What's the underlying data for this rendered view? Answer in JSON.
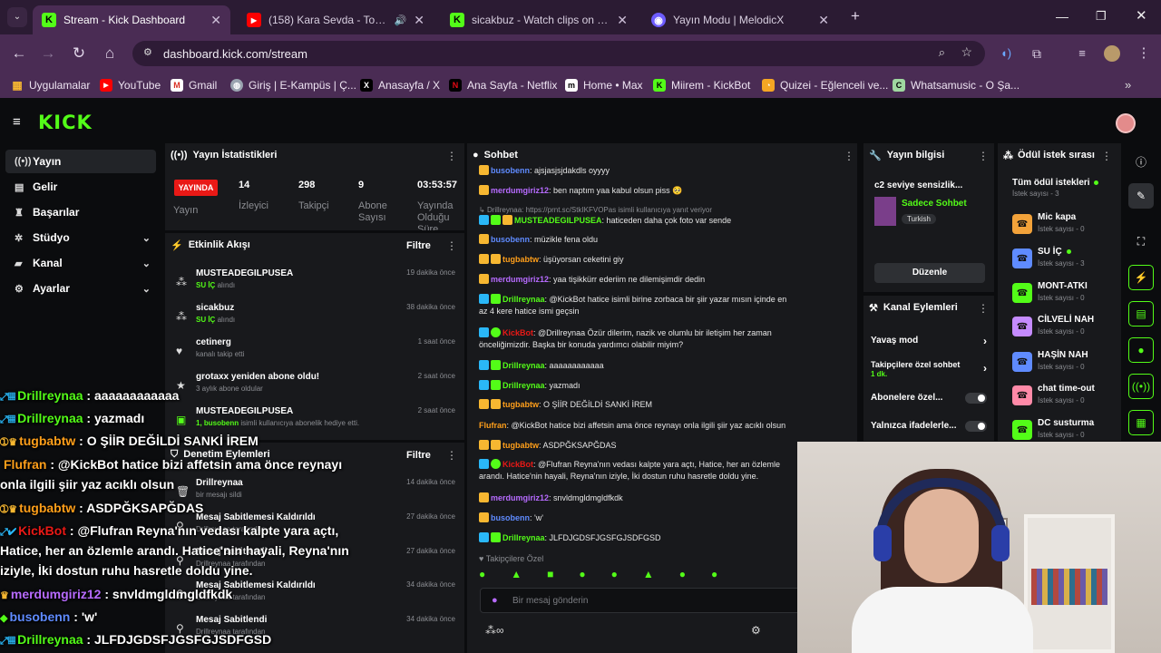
{
  "browser": {
    "tabs": [
      {
        "title": "Stream - Kick Dashboard",
        "icon": "kick-icon",
        "active": true
      },
      {
        "title": "(158) Kara Sevda - Toygar I",
        "icon": "youtube-icon",
        "active": false
      },
      {
        "title": "sicakbuz - Watch clips on Kick",
        "icon": "kick-icon",
        "active": false
      },
      {
        "title": "Yayın Modu | MelodicX",
        "icon": "melodicx-icon",
        "active": false
      }
    ],
    "url": "dashboard.kick.com/stream",
    "bookmarks": [
      {
        "label": "Uygulamalar",
        "icon": "apps-icon"
      },
      {
        "label": "YouTube",
        "icon": "youtube-icon"
      },
      {
        "label": "Gmail",
        "icon": "gmail-icon"
      },
      {
        "label": "Giriş | E-Kampüs | Ç...",
        "icon": "campus-icon"
      },
      {
        "label": "Anasayfa / X",
        "icon": "x-icon"
      },
      {
        "label": "Ana Sayfa - Netflix",
        "icon": "netflix-icon"
      },
      {
        "label": "Home • Max",
        "icon": "max-icon"
      },
      {
        "label": "Miirem - KickBot",
        "icon": "kickbot-icon"
      },
      {
        "label": "Quizei - Eğlenceli ve...",
        "icon": "quizei-icon"
      },
      {
        "label": "Whatsamusic - O Şa...",
        "icon": "whatsamusic-icon"
      }
    ]
  },
  "kick": {
    "logo": "KICK",
    "sidebar": [
      {
        "label": "Yayın",
        "icon": "stream-icon",
        "active": true
      },
      {
        "label": "Gelir",
        "icon": "revenue-icon"
      },
      {
        "label": "Başarılar",
        "icon": "trophy-icon"
      },
      {
        "label": "Stüdyo",
        "icon": "studio-icon",
        "expandable": true
      },
      {
        "label": "Kanal",
        "icon": "channel-icon",
        "expandable": true
      },
      {
        "label": "Ayarlar",
        "icon": "settings-icon",
        "expandable": true
      }
    ],
    "stats": {
      "title": "Yayın İstatistikleri",
      "live_badge": "YAYINDA",
      "items": [
        {
          "value": "",
          "label": "Yayın"
        },
        {
          "value": "14",
          "label": "İzleyici"
        },
        {
          "value": "298",
          "label": "Takipçi"
        },
        {
          "value": "9",
          "label": "Abone Sayısı"
        },
        {
          "value": "03:53:57",
          "label": "Yayında Olduğu Süre"
        }
      ]
    },
    "activity": {
      "title": "Etkinlik Akışı",
      "filter": "Filtre",
      "events": [
        {
          "name": "MUSTEADEGILPUSEA",
          "highlight": "SU İÇ",
          "sub": "alındı",
          "time": "19 dakika önce"
        },
        {
          "name": "sicakbuz",
          "highlight": "SU İÇ",
          "sub": "alındı",
          "time": "38 dakika önce"
        },
        {
          "name": "cetinerg",
          "highlight": "",
          "sub": "kanalı takip etti",
          "time": "1 saat önce"
        },
        {
          "name": "grotaxx yeniden abone oldu!",
          "highlight": "",
          "sub": "3 aylık abone oldular",
          "time": "2 saat önce"
        },
        {
          "name": "MUSTEADEGILPUSEA",
          "highlight": "1, busobenn",
          "sub": "isimli kullanıcıya abonelik hediye etti.",
          "time": "2 saat önce"
        }
      ]
    },
    "moderation": {
      "title": "Denetim Eylemleri",
      "filter": "Filtre",
      "events": [
        {
          "name": "Drillreynaa",
          "sub": "bir mesajı sildi",
          "time": "14 dakika önce"
        },
        {
          "name": "Mesaj Sabitlemesi Kaldırıldı",
          "sub": "Drillreynaa tarafından",
          "time": "27 dakika önce"
        },
        {
          "name": "Mesaj Sabitlendi",
          "sub": "Drillreynaa tarafından",
          "time": "27 dakika önce"
        },
        {
          "name": "Mesaj Sabitlemesi Kaldırıldı",
          "sub": "Drillreynaa tarafından",
          "time": "34 dakika önce"
        },
        {
          "name": "Mesaj Sabitlendi",
          "sub": "Drillreynaa tarafından",
          "time": "34 dakika önce"
        }
      ]
    },
    "chat": {
      "title": "Sohbet",
      "messages": [
        {
          "user": "busobenn",
          "color": "#5f8bff",
          "text": "ajsjasjsjdakdls oyyyy"
        },
        {
          "user": "merdumgiriz12",
          "color": "#b76bff",
          "text": "ben naptım yaa kabul olsun piss"
        },
        {
          "user": "MUSTEADEGILPUSEA",
          "color": "#53fc18",
          "text": "haticeden daha çok foto var sende",
          "reply": "Drillreynaa: https://prnt.sc/StkIKFVOPas isimli kullanıcıya yanıt veriyor"
        },
        {
          "user": "busobenn",
          "color": "#5f8bff",
          "text": "müzikle fena oldu"
        },
        {
          "user": "tugbabtw",
          "color": "#ff9f1a",
          "text": "üşüyorsan ceketini giy"
        },
        {
          "user": "merdumgiriz12",
          "color": "#b76bff",
          "text": "yaa tişikkürr ederiim  ne dilemişimdir dedin"
        },
        {
          "user": "Drillreynaa",
          "color": "#53fc18",
          "text": "@KickBot hatice isimli birine zorbaca bir şiir yazar mısın içinde en az 4 kere hatice ismi geçsin"
        },
        {
          "user": "KickBot",
          "color": "#e91916",
          "text": "@Drillreynaa Özür dilerim, nazik ve olumlu bir iletişim her zaman önceliğimizdir. Başka bir konuda yardımcı olabilir miyim?"
        },
        {
          "user": "Drillreynaa",
          "color": "#53fc18",
          "text": "aaaaaaaaaaaa"
        },
        {
          "user": "Drillreynaa",
          "color": "#53fc18",
          "text": "yazmadı"
        },
        {
          "user": "tugbabtw",
          "color": "#ff9f1a",
          "text": "O ŞİİR DEĞİLDİ SANKİ İREM"
        },
        {
          "user": "Flufran",
          "color": "#ff9f1a",
          "text": "@KickBot hatice bizi affetsin ama önce reynayı onla ilgili şiir yaz acıklı olsun"
        },
        {
          "user": "tugbabtw",
          "color": "#ff9f1a",
          "text": "ASDPĞKSAPĞDAS"
        },
        {
          "user": "KickBot",
          "color": "#e91916",
          "text": "@Flufran Reyna'nın vedası kalpte yara açtı, Hatice, her an özlemle arandı. Hatice'nin hayali, Reyna'nın iziyle, İki dostun ruhu hasretle doldu yine."
        },
        {
          "user": "merdumgiriz12",
          "color": "#b76bff",
          "text": "snvldmgldmgldfkdk"
        },
        {
          "user": "busobenn",
          "color": "#5f8bff",
          "text": "'w'"
        },
        {
          "user": "Drillreynaa",
          "color": "#53fc18",
          "text": "JLFDJGDSFJGSFGJSDFGSD"
        }
      ],
      "followers_label": "Takipçilere Özel",
      "input_placeholder": "Bir mesaj gönderin"
    },
    "stream_info": {
      "title": "Yayın bilgisi",
      "stream_title": "c2 seviye sensizlik...",
      "category": "Sadece Sohbet",
      "tag": "Turkish",
      "edit_button": "Düzenle"
    },
    "channel_actions": {
      "title": "Kanal Eylemleri",
      "items": [
        {
          "label": "Yavaş mod",
          "type": "arrow"
        },
        {
          "label": "Takipçilere özel sohbet",
          "sub": "1 dk.",
          "type": "arrow"
        },
        {
          "label": "Abonelere özel...",
          "type": "toggle"
        },
        {
          "label": "Yalnızca ifadelerle...",
          "type": "toggle"
        }
      ]
    },
    "rewards": {
      "title": "Ödül istek sırası",
      "all_label": "Tüm ödül istekleri",
      "all_count": "İstek sayısı - 3",
      "items": [
        {
          "name": "Mic kapa",
          "count": "İstek sayısı - 0",
          "color": "#f2a23a"
        },
        {
          "name": "SU İÇ",
          "count": "İstek sayısı - 3",
          "color": "#5f8bff"
        },
        {
          "name": "MONT-ATKI",
          "count": "İstek sayısı - 0",
          "color": "#53fc18"
        },
        {
          "name": "CİLVELİ NAH",
          "count": "İstek sayısı - 0",
          "color": "#c58bff"
        },
        {
          "name": "HAŞİN NAH",
          "count": "İstek sayısı - 0",
          "color": "#5f8bff"
        },
        {
          "name": "chat time-out",
          "count": "İstek sayısı - 0",
          "color": "#ff8aa8"
        },
        {
          "name": "DC susturma",
          "count": "İstek sayısı - 0",
          "color": "#53fc18"
        }
      ]
    }
  },
  "overlay_chat": [
    {
      "user": "Drillreynaa",
      "color": "#53fc18",
      "text": "aaaaaaaaaaaa"
    },
    {
      "user": "Drillreynaa",
      "color": "#53fc18",
      "text": "yazmadı"
    },
    {
      "user": "tugbabtw",
      "color": "#ff9f1a",
      "text": "O ŞİİR DEĞİLDİ SANKİ İREM"
    },
    {
      "user": "Flufran",
      "color": "#ff9f1a",
      "text": "@KickBot hatice bizi affetsin ama önce reynayı"
    },
    {
      "user": "",
      "color": "#fff",
      "text": "onla ilgili şiir yaz acıklı olsun"
    },
    {
      "user": "tugbabtw",
      "color": "#ff9f1a",
      "text": "ASDPĞKSAPĞDAS"
    },
    {
      "user": "KickBot",
      "color": "#e91916",
      "text": "@Flufran Reyna'nın vedası kalpte yara açtı,"
    },
    {
      "user": "",
      "color": "#fff",
      "text": "Hatice, her an özlemle arandı. Hatice'nin hayali, Reyna'nın"
    },
    {
      "user": "",
      "color": "#fff",
      "text": "iziyle, İki dostun ruhu hasretle doldu yine."
    },
    {
      "user": "merdumgiriz12",
      "color": "#b76bff",
      "text": "snvldmgldmgldfkdk"
    },
    {
      "user": "busobenn",
      "color": "#5f8bff",
      "text": "'w'"
    },
    {
      "user": "Drillreynaa",
      "color": "#53fc18",
      "text": "JLFDJGDSFJGSFGJSDFGSD"
    }
  ]
}
